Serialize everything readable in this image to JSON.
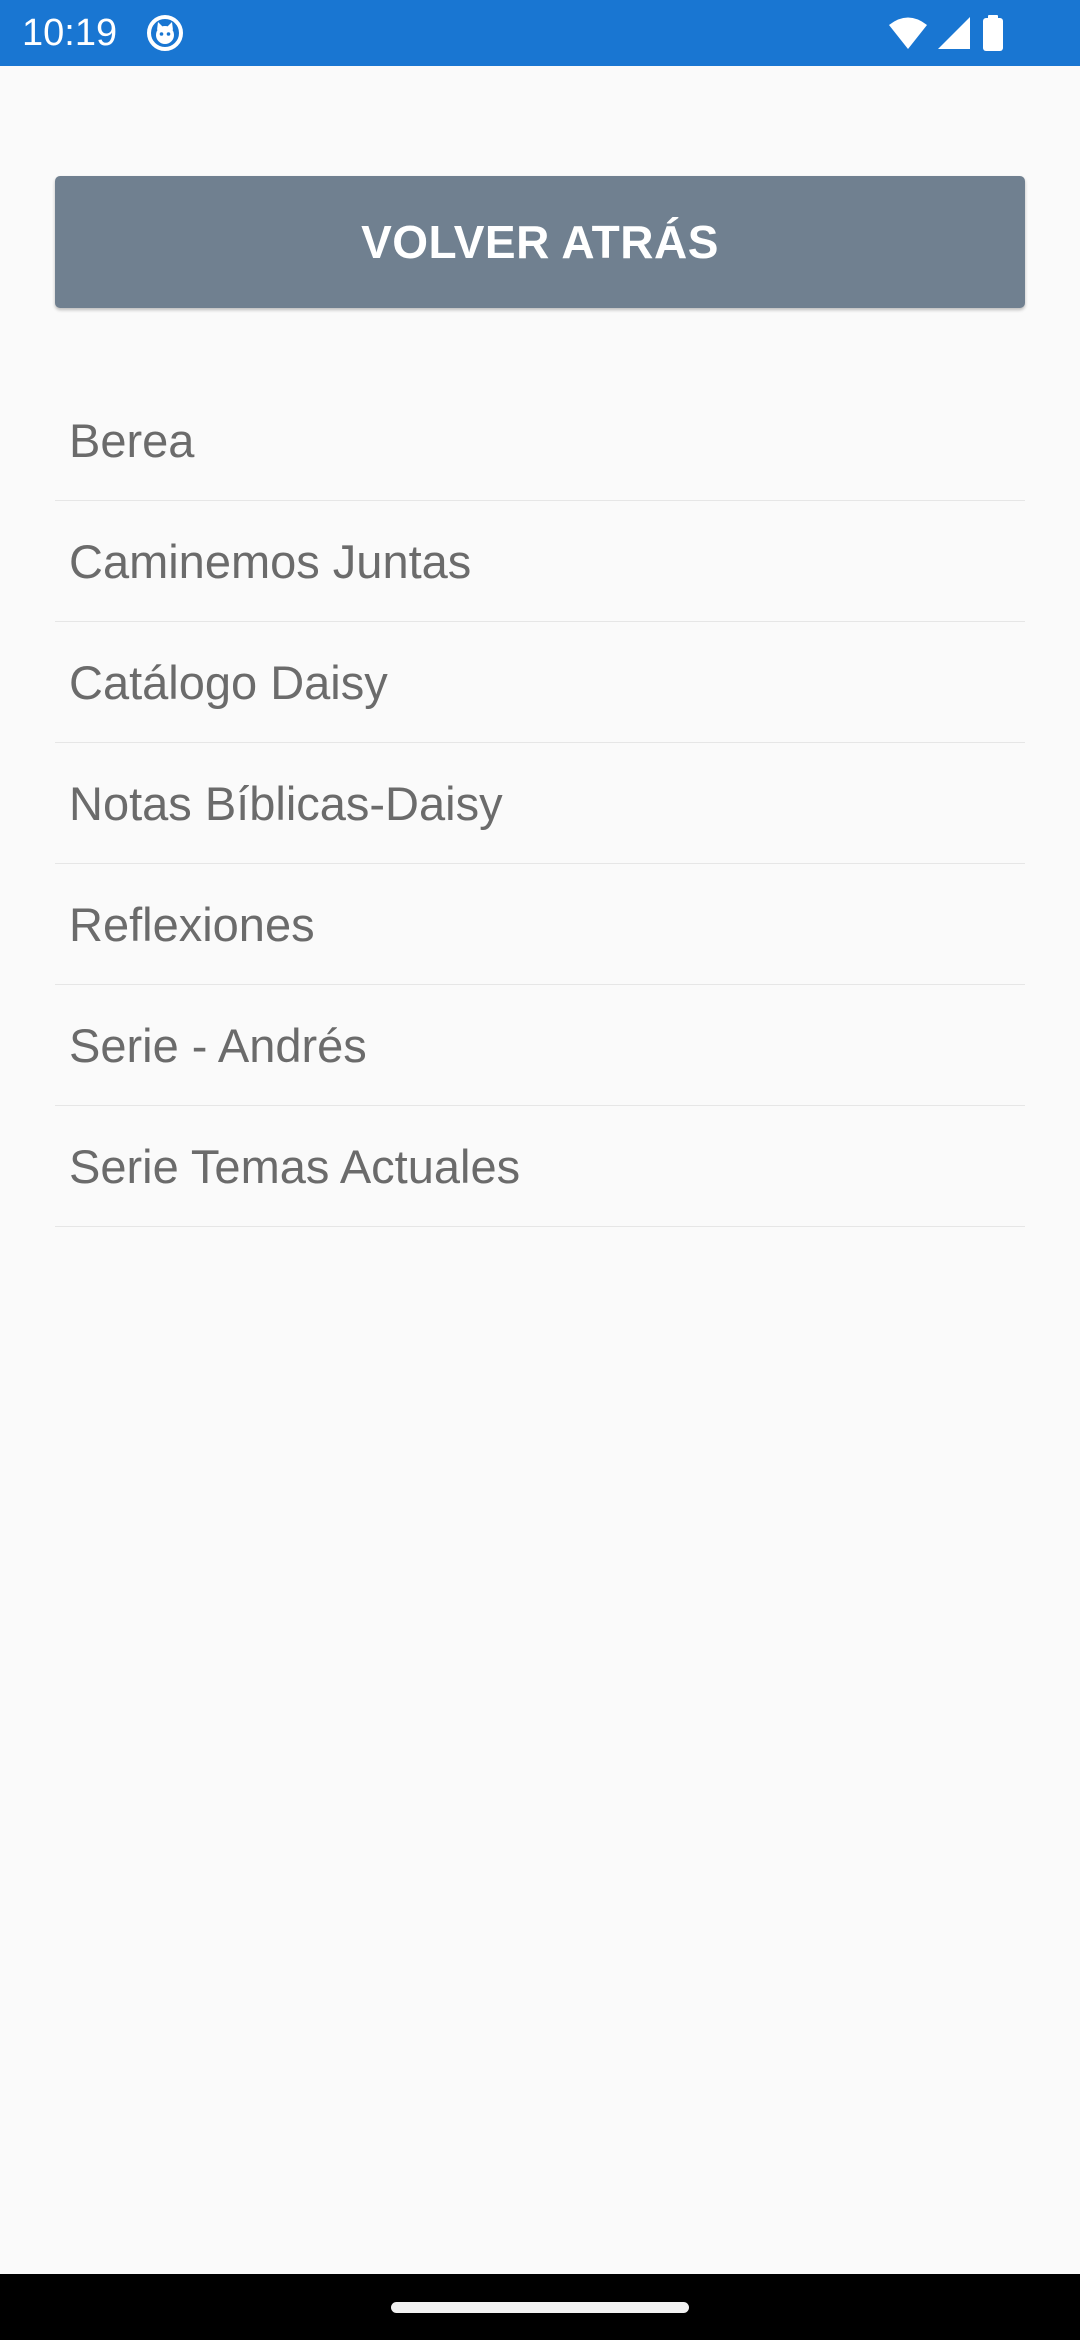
{
  "status_bar": {
    "time": "10:19",
    "app_icon": "cat-face-icon",
    "icons": [
      "wifi-icon",
      "signal-icon",
      "battery-icon"
    ],
    "background_color": "#1976d2"
  },
  "back_button": {
    "label": "VOLVER ATRÁS",
    "background_color": "#708090"
  },
  "list": {
    "items": [
      {
        "label": "Berea"
      },
      {
        "label": "Caminemos Juntas"
      },
      {
        "label": "Catálogo Daisy"
      },
      {
        "label": "Notas Bíblicas-Daisy"
      },
      {
        "label": "Reflexiones"
      },
      {
        "label": "Serie - Andrés"
      },
      {
        "label": "Serie Temas Actuales"
      }
    ]
  }
}
